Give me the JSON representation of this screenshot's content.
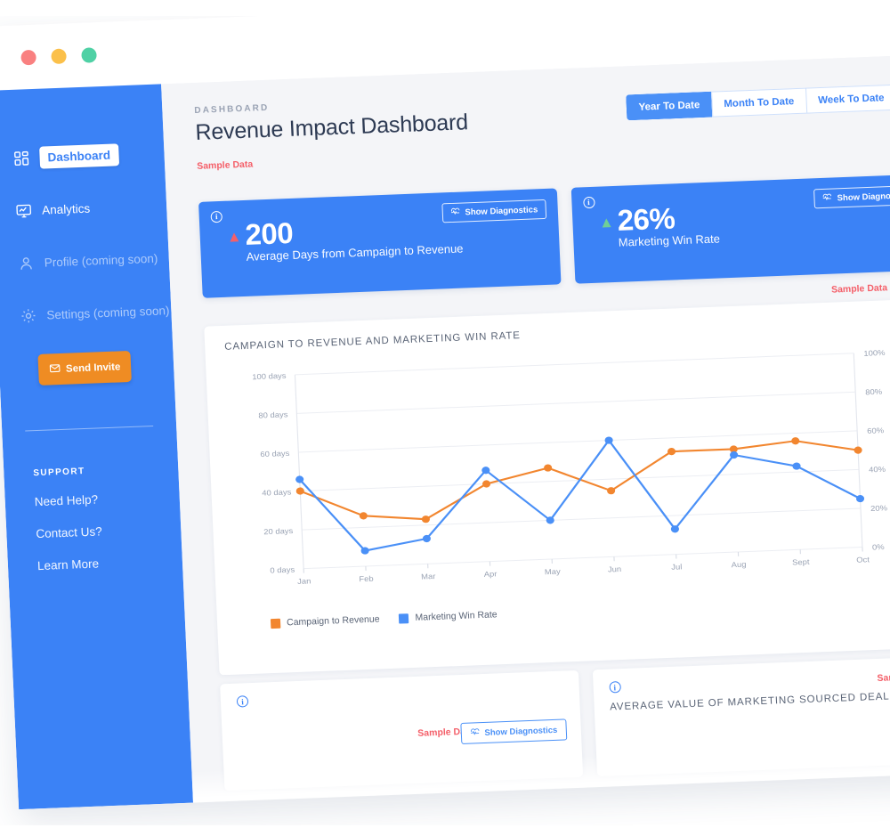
{
  "window": {
    "dots": [
      "close-dot",
      "minimize-dot",
      "maximize-dot"
    ]
  },
  "sidebar": {
    "items": [
      {
        "label": "Dashboard",
        "icon": "grid-icon",
        "state": "active"
      },
      {
        "label": "Analytics",
        "icon": "monitor-chart-icon",
        "state": "default"
      },
      {
        "label": "Profile (coming soon)",
        "icon": "user-icon",
        "state": "disabled"
      },
      {
        "label": "Settings (coming soon)",
        "icon": "gear-icon",
        "state": "disabled"
      }
    ],
    "invite_button": {
      "label": "Send Invite",
      "icon": "envelope-icon"
    },
    "support_title": "SUPPORT",
    "support_links": [
      {
        "label": "Need Help?"
      },
      {
        "label": "Contact Us?"
      },
      {
        "label": "Learn More"
      }
    ]
  },
  "header": {
    "eyebrow": "DASHBOARD",
    "title": "Revenue Impact Dashboard",
    "sample_data": "Sample Data",
    "ranges": [
      {
        "label": "Year To Date",
        "active": true
      },
      {
        "label": "Month To Date",
        "active": false
      },
      {
        "label": "Week To Date",
        "active": false
      }
    ],
    "calendar_icon": "calendar-icon"
  },
  "kpis": [
    {
      "value": "200",
      "label": "Average Days from Campaign to Revenue",
      "trend": "up",
      "trend_color": "#f4606a",
      "diagnostics_label": "Show Diagnostics",
      "info_glyph": "i"
    },
    {
      "value": "26%",
      "label": "Marketing Win Rate",
      "trend": "up",
      "trend_color": "#6fcf97",
      "diagnostics_label": "Show Diagnostics",
      "info_glyph": "i"
    }
  ],
  "kpi_sample_data": "Sample Data",
  "chart_card": {
    "title": "CAMPAIGN TO REVENUE AND MARKETING WIN RATE"
  },
  "chart_data": {
    "type": "line",
    "title": "CAMPAIGN TO REVENUE AND MARKETING WIN RATE",
    "categories": [
      "Jan",
      "Feb",
      "Mar",
      "Apr",
      "May",
      "Jun",
      "Jul",
      "Aug",
      "Sept",
      "Oct"
    ],
    "series": [
      {
        "name": "Campaign to Revenue",
        "color": "#f2862f",
        "axis": "left",
        "unit": "days",
        "values": [
          40,
          26,
          23,
          40,
          47,
          34,
          53,
          53,
          56,
          50
        ]
      },
      {
        "name": "Marketing Win Rate",
        "color": "#4a90f7",
        "axis": "right",
        "unit": "%",
        "values": [
          46,
          8,
          13,
          47,
          20,
          60,
          13,
          50,
          43,
          25
        ]
      }
    ],
    "left_axis": {
      "label": "days",
      "ticks": [
        "0 days",
        "20 days",
        "40 days",
        "60 days",
        "80 days",
        "100 days"
      ],
      "min": 0,
      "max": 100
    },
    "right_axis": {
      "label": "%",
      "ticks": [
        "0%",
        "20%",
        "40%",
        "60%",
        "80%",
        "100%"
      ],
      "min": 0,
      "max": 100
    },
    "xlabel": "",
    "grid": true,
    "legend_position": "bottom-left",
    "legend": [
      "Campaign to Revenue",
      "Marketing Win Rate"
    ]
  },
  "bottom_cards": [
    {
      "title": "",
      "sample_data": "Sample Data",
      "diagnostics_label": "Show Diagnostics",
      "info_glyph": "i"
    },
    {
      "title": "AVERAGE VALUE OF MARKETING SOURCED DEALS",
      "sample_data": "Sample Data",
      "info_glyph": "i"
    }
  ],
  "colors": {
    "brand_blue": "#3b82f6",
    "accent_orange": "#ef8c23",
    "series_orange": "#f2862f",
    "series_blue": "#4a90f7",
    "sample_red": "#f4606a",
    "trend_up_green": "#6fcf97",
    "page_bg": "#f4f5f8"
  }
}
